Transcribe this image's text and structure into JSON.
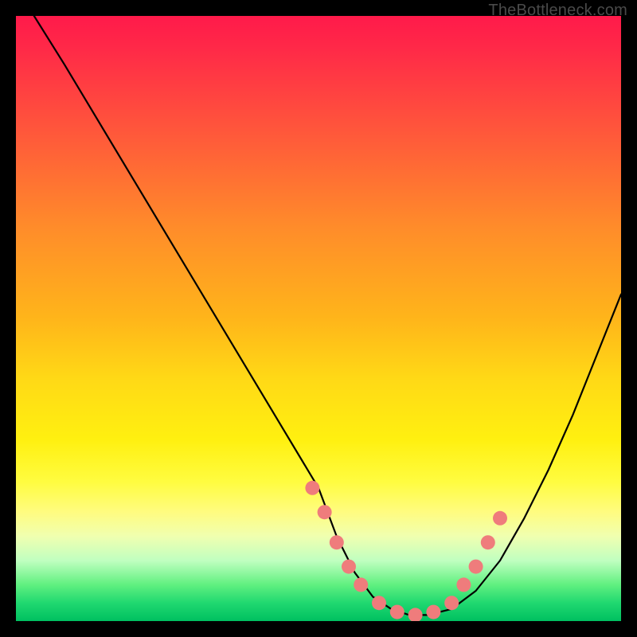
{
  "watermark": "TheBottleneck.com",
  "chart_data": {
    "type": "line",
    "title": "",
    "xlabel": "",
    "ylabel": "",
    "xlim": [
      0,
      100
    ],
    "ylim": [
      0,
      100
    ],
    "grid": false,
    "series": [
      {
        "name": "curve",
        "color": "#000000",
        "x": [
          3,
          8,
          14,
          20,
          26,
          32,
          38,
          44,
          50,
          53,
          56,
          59,
          62,
          65,
          68,
          72,
          76,
          80,
          84,
          88,
          92,
          96,
          100
        ],
        "y": [
          100,
          92,
          82,
          72,
          62,
          52,
          42,
          32,
          22,
          14,
          8,
          4,
          2,
          1,
          1,
          2,
          5,
          10,
          17,
          25,
          34,
          44,
          54
        ]
      }
    ],
    "markers": {
      "name": "pink-dots",
      "color": "#ef7c7c",
      "points": [
        {
          "x": 49,
          "y": 22
        },
        {
          "x": 51,
          "y": 18
        },
        {
          "x": 53,
          "y": 13
        },
        {
          "x": 55,
          "y": 9
        },
        {
          "x": 57,
          "y": 6
        },
        {
          "x": 60,
          "y": 3
        },
        {
          "x": 63,
          "y": 1.5
        },
        {
          "x": 66,
          "y": 1
        },
        {
          "x": 69,
          "y": 1.5
        },
        {
          "x": 72,
          "y": 3
        },
        {
          "x": 74,
          "y": 6
        },
        {
          "x": 76,
          "y": 9
        },
        {
          "x": 78,
          "y": 13
        },
        {
          "x": 80,
          "y": 17
        }
      ]
    }
  }
}
